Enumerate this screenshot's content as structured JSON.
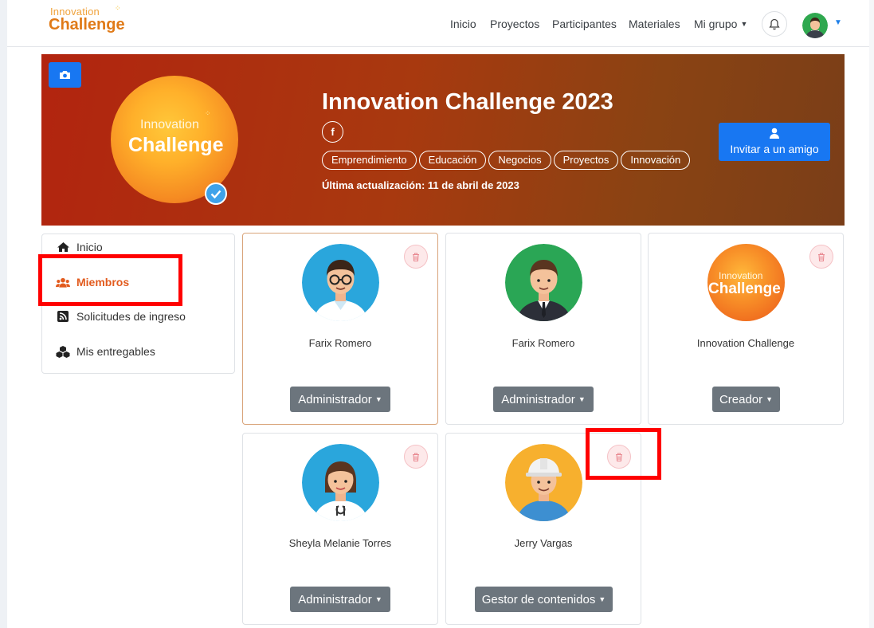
{
  "brand": {
    "line1": "Innovation",
    "line2": "Challenge"
  },
  "nav": {
    "items": [
      "Inicio",
      "Proyectos",
      "Participantes",
      "Materiales"
    ],
    "group_label": "Mi grupo",
    "bell_icon": "bell-icon",
    "avatar_icon": "user-avatar"
  },
  "banner": {
    "title": "Innovation Challenge 2023",
    "logo_line1": "Innovation",
    "logo_line2": "Challenge",
    "social_icon": "f",
    "tags": [
      "Emprendimiento",
      "Educación",
      "Negocios",
      "Proyectos",
      "Innovación"
    ],
    "updated": "Última actualización: 11 de abril de 2023",
    "invite_label": "Invitar a un amigo"
  },
  "sidebar": {
    "items": [
      {
        "label": "Inicio",
        "icon": "home-icon"
      },
      {
        "label": "Miembros",
        "icon": "users-icon",
        "active": true
      },
      {
        "label": "Solicitudes de ingreso",
        "icon": "rss-icon"
      },
      {
        "label": "Mis entregables",
        "icon": "cubes-icon"
      }
    ]
  },
  "members": [
    {
      "name": "Farix Romero",
      "role": "Administrador",
      "avatar": "doctor-glasses-avatar"
    },
    {
      "name": "Farix Romero",
      "role": "Administrador",
      "avatar": "businessman-avatar"
    },
    {
      "name": "Innovation Challenge",
      "role": "Creador",
      "avatar": "innovation-challenge-logo",
      "logo_line1": "Innovation",
      "logo_line2": "Challenge"
    },
    {
      "name": "Sheyla Melanie Torres",
      "role": "Administrador",
      "avatar": "female-doctor-avatar"
    },
    {
      "name": "Jerry Vargas",
      "role": "Gestor de contenidos",
      "avatar": "construction-worker-avatar"
    }
  ],
  "colors": {
    "accent": "#1877f2",
    "active": "#e25b1e",
    "role_button": "#6c757d",
    "highlight": "#ff0000",
    "banner_start": "#b2240f",
    "banner_end": "#7a3e18"
  }
}
